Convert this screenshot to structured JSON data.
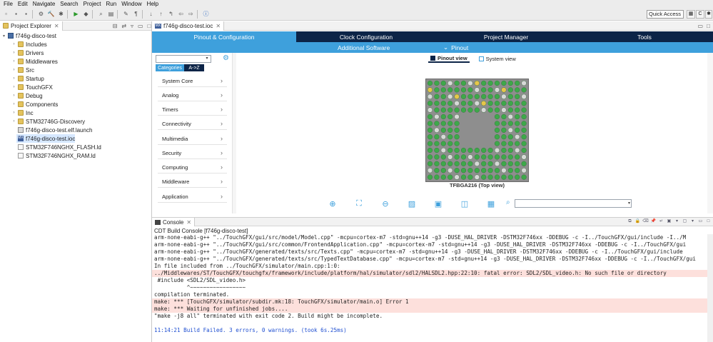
{
  "menu": [
    "File",
    "Edit",
    "Navigate",
    "Search",
    "Project",
    "Run",
    "Window",
    "Help"
  ],
  "toolbar": {
    "quick_access": "Quick Access"
  },
  "project_explorer": {
    "title": "Project Explorer",
    "items": [
      {
        "label": "f746g-disco-test",
        "type": "project",
        "expanded": true
      },
      {
        "label": "Includes",
        "type": "folder"
      },
      {
        "label": "Drivers",
        "type": "folder"
      },
      {
        "label": "Middlewares",
        "type": "folder"
      },
      {
        "label": "Src",
        "type": "folder"
      },
      {
        "label": "Startup",
        "type": "folder"
      },
      {
        "label": "TouchGFX",
        "type": "folder"
      },
      {
        "label": "Debug",
        "type": "folder"
      },
      {
        "label": "Components",
        "type": "folder"
      },
      {
        "label": "Inc",
        "type": "folder"
      },
      {
        "label": "STM32746G-Discovery",
        "type": "folder"
      },
      {
        "label": "f746g-disco-test.elf.launch",
        "type": "launch"
      },
      {
        "label": "f746g-disco-test.ioc",
        "type": "ioc",
        "selected": true
      },
      {
        "label": "STM32F746NGHX_FLASH.ld",
        "type": "file"
      },
      {
        "label": "STM32F746NGHX_RAM.ld",
        "type": "file"
      }
    ]
  },
  "editor": {
    "tab_label": "f746g-disco-test.ioc",
    "nav_tabs": [
      "Pinout & Configuration",
      "Clock Configuration",
      "Project Manager",
      "Tools"
    ],
    "sub_tabs": [
      "Additional Software",
      "Pinout"
    ],
    "categories": {
      "toggle_categories": "Categories",
      "toggle_az": "A->Z",
      "items": [
        "System Core",
        "Analog",
        "Timers",
        "Connectivity",
        "Multimedia",
        "Security",
        "Computing",
        "Middleware",
        "Application"
      ]
    },
    "views": {
      "pinout_view": "Pinout view",
      "system_view": "System view"
    },
    "chip_label": "TFBGA216 (Top view)"
  },
  "console": {
    "tab_label": "Console",
    "title": "CDT Build Console [f746g-disco-test]",
    "lines": [
      {
        "text": "arm-none-eabi-g++ \"../TouchGFX/gui/src/model/Model.cpp\" -mcpu=cortex-m7 -std=gnu++14 -g3 -DUSE_HAL_DRIVER -DSTM32F746xx -DDEBUG -c -I../TouchGFX/gui/include -I../M",
        "kind": "normal"
      },
      {
        "text": "arm-none-eabi-g++ \"../TouchGFX/gui/src/common/FrontendApplication.cpp\" -mcpu=cortex-m7 -std=gnu++14 -g3 -DUSE_HAL_DRIVER -DSTM32F746xx -DDEBUG -c -I../TouchGFX/gui",
        "kind": "normal"
      },
      {
        "text": "arm-none-eabi-g++ \"../TouchGFX/generated/texts/src/Texts.cpp\" -mcpu=cortex-m7 -std=gnu++14 -g3 -DUSE_HAL_DRIVER -DSTM32F746xx -DDEBUG -c -I../TouchGFX/gui/include",
        "kind": "normal"
      },
      {
        "text": "arm-none-eabi-g++ \"../TouchGFX/generated/texts/src/TypedTextDatabase.cpp\" -mcpu=cortex-m7 -std=gnu++14 -g3 -DUSE_HAL_DRIVER -DSTM32F746xx -DDEBUG -c -I../TouchGFX/gui",
        "kind": "normal"
      },
      {
        "text": "In file included from ../TouchGFX/simulator/main.cpp:1:0:",
        "kind": "normal"
      },
      {
        "text": "../Middlewares/ST/TouchGFX/touchgfx/framework/include/platform/hal/simulator/sdl2/HALSDL2.hpp:22:10: fatal error: SDL2/SDL_video.h: No such file or directory",
        "kind": "error"
      },
      {
        "text": " #include <SDL2/SDL_video.h>",
        "kind": "normal"
      },
      {
        "text": "          ^~~~~~~~~~~~~~~~~~",
        "kind": "normal"
      },
      {
        "text": "compilation terminated.",
        "kind": "normal"
      },
      {
        "text": "make: *** [TouchGFX/simulator/subdir.mk:18: TouchGFX/simulator/main.o] Error 1",
        "kind": "error"
      },
      {
        "text": "make: *** Waiting for unfinished jobs....",
        "kind": "error"
      },
      {
        "text": "\"make -j8 all\" terminated with exit code 2. Build might be incomplete.",
        "kind": "normal"
      },
      {
        "text": "",
        "kind": "normal"
      },
      {
        "text": "11:14:21 Build Failed. 3 errors, 0 warnings. (took 6s.25ms)",
        "kind": "blue"
      }
    ]
  }
}
